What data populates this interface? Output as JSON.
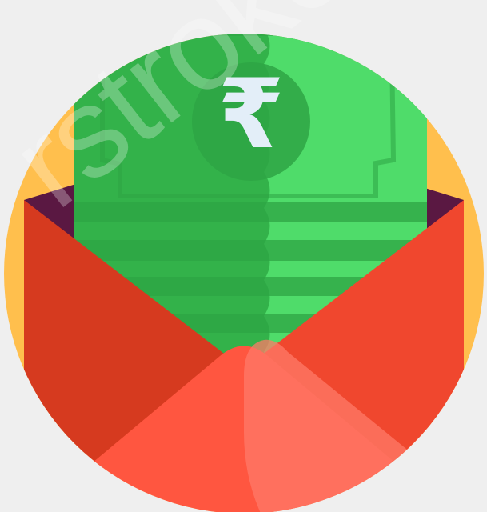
{
  "illustration": {
    "icon": "rupee-money-envelope-icon",
    "currency_symbol": "₹"
  },
  "watermark": {
    "text": "rstrokcom"
  },
  "colors": {
    "background": "#efefef",
    "circle": "#ffbf4d",
    "envelope_inner": "#5a1842",
    "envelope_left": "#d63a1f",
    "envelope_right": "#f0472e",
    "envelope_bottom": "#ff5640",
    "envelope_highlight": "#ff7a68",
    "note_dark": "#33b24a",
    "note_light": "#4fdc6a",
    "note_stripe": "#2ea444",
    "rupee": "#e3eef8"
  }
}
